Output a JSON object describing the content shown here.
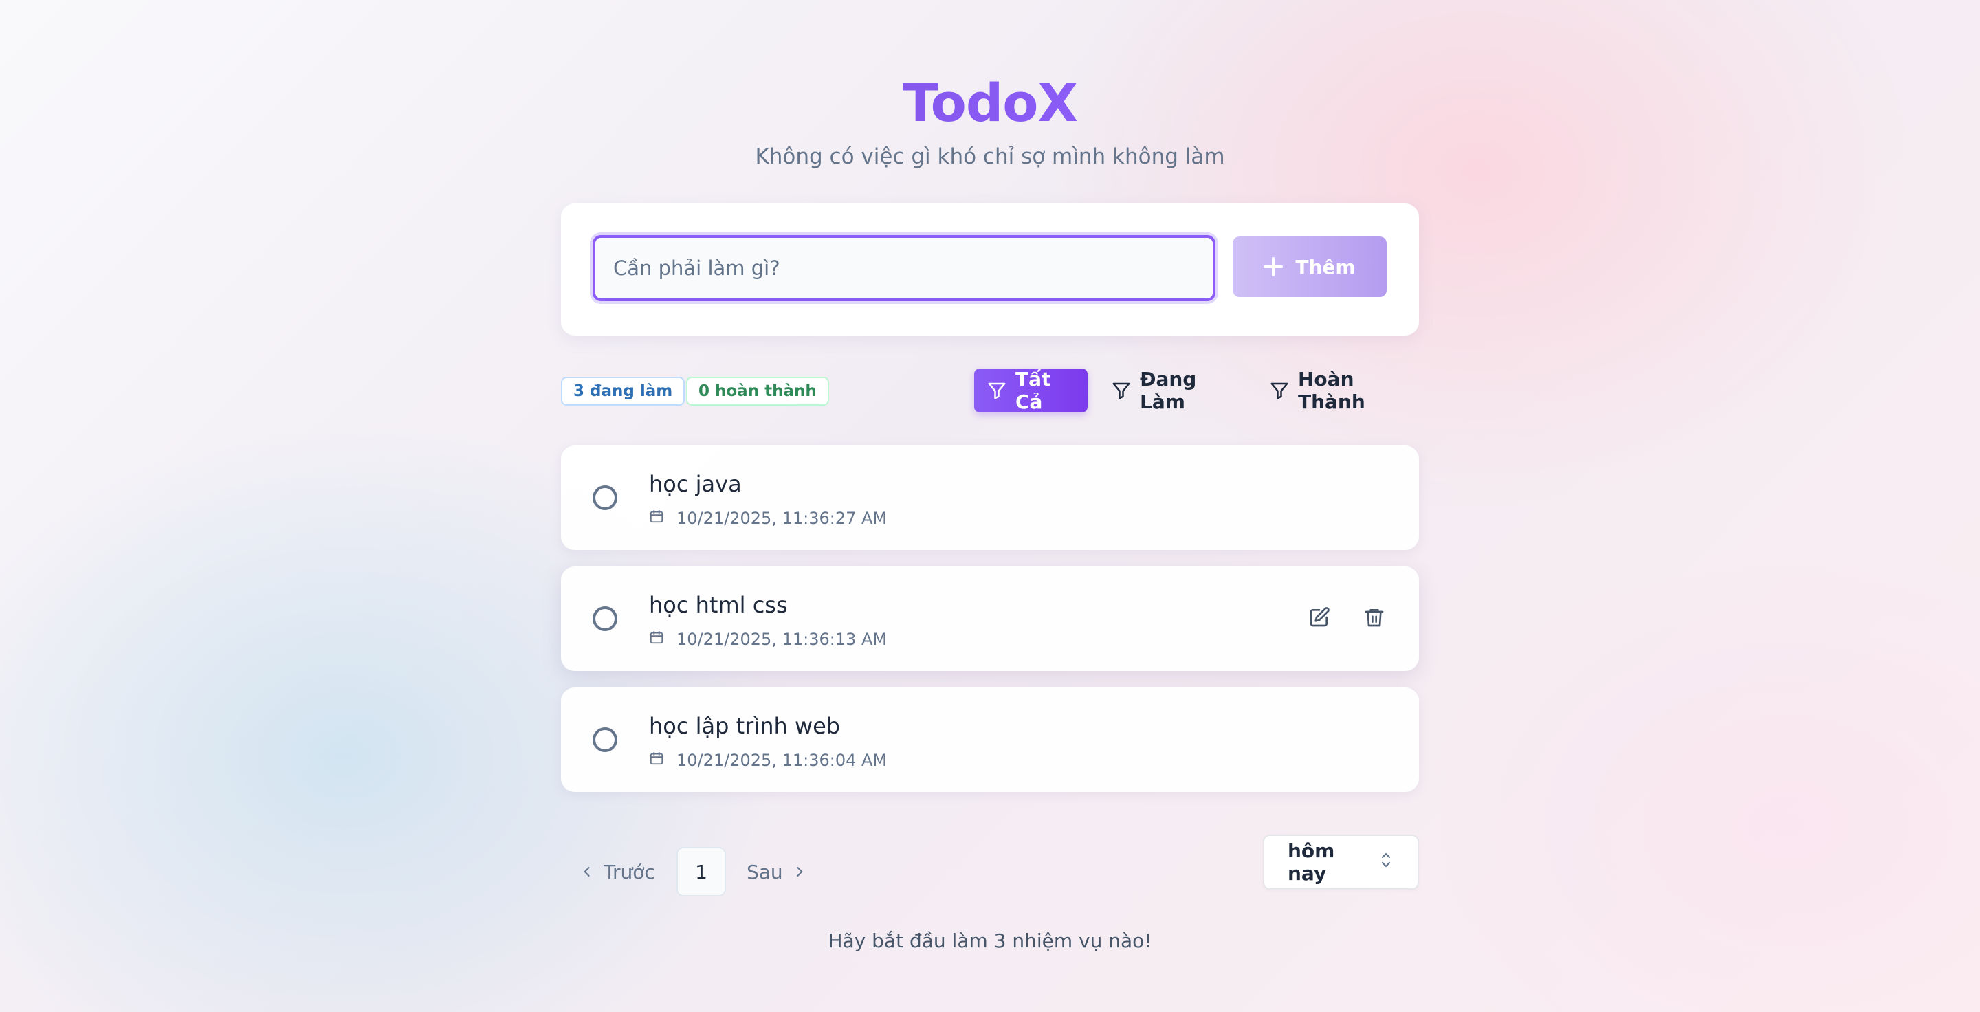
{
  "header": {
    "title": "TodoX",
    "subtitle": "Không có việc gì khó chỉ sợ mình không làm"
  },
  "add_task": {
    "placeholder": "Cần phải làm gì?",
    "value": "",
    "button_label": "Thêm",
    "button_icon": "plus-icon"
  },
  "stats": {
    "active_label": "3 đang làm",
    "done_label": "0 hoàn thành"
  },
  "filters": {
    "all_label": "Tất Cả",
    "active_label": "Đang Làm",
    "done_label": "Hoàn Thành",
    "selected": "all",
    "icon": "filter-icon"
  },
  "tasks": [
    {
      "title": "học java",
      "timestamp": "10/21/2025, 11:36:27 AM",
      "completed": false
    },
    {
      "title": "học html css",
      "timestamp": "10/21/2025, 11:36:13 AM",
      "completed": false
    },
    {
      "title": "học lập trình web",
      "timestamp": "10/21/2025, 11:36:04 AM",
      "completed": false
    }
  ],
  "pagination": {
    "prev_label": "Trước",
    "current_page": "1",
    "next_label": "Sau"
  },
  "date_filter": {
    "selected": "hôm nay"
  },
  "footer": {
    "message": "Hãy bắt đầu làm 3 nhiệm vụ nào!"
  },
  "colors": {
    "brand": "#7c4ddf",
    "accent": "#8b5cf6",
    "active_badge": "#2f6fb4",
    "done_badge": "#2e8b57"
  }
}
